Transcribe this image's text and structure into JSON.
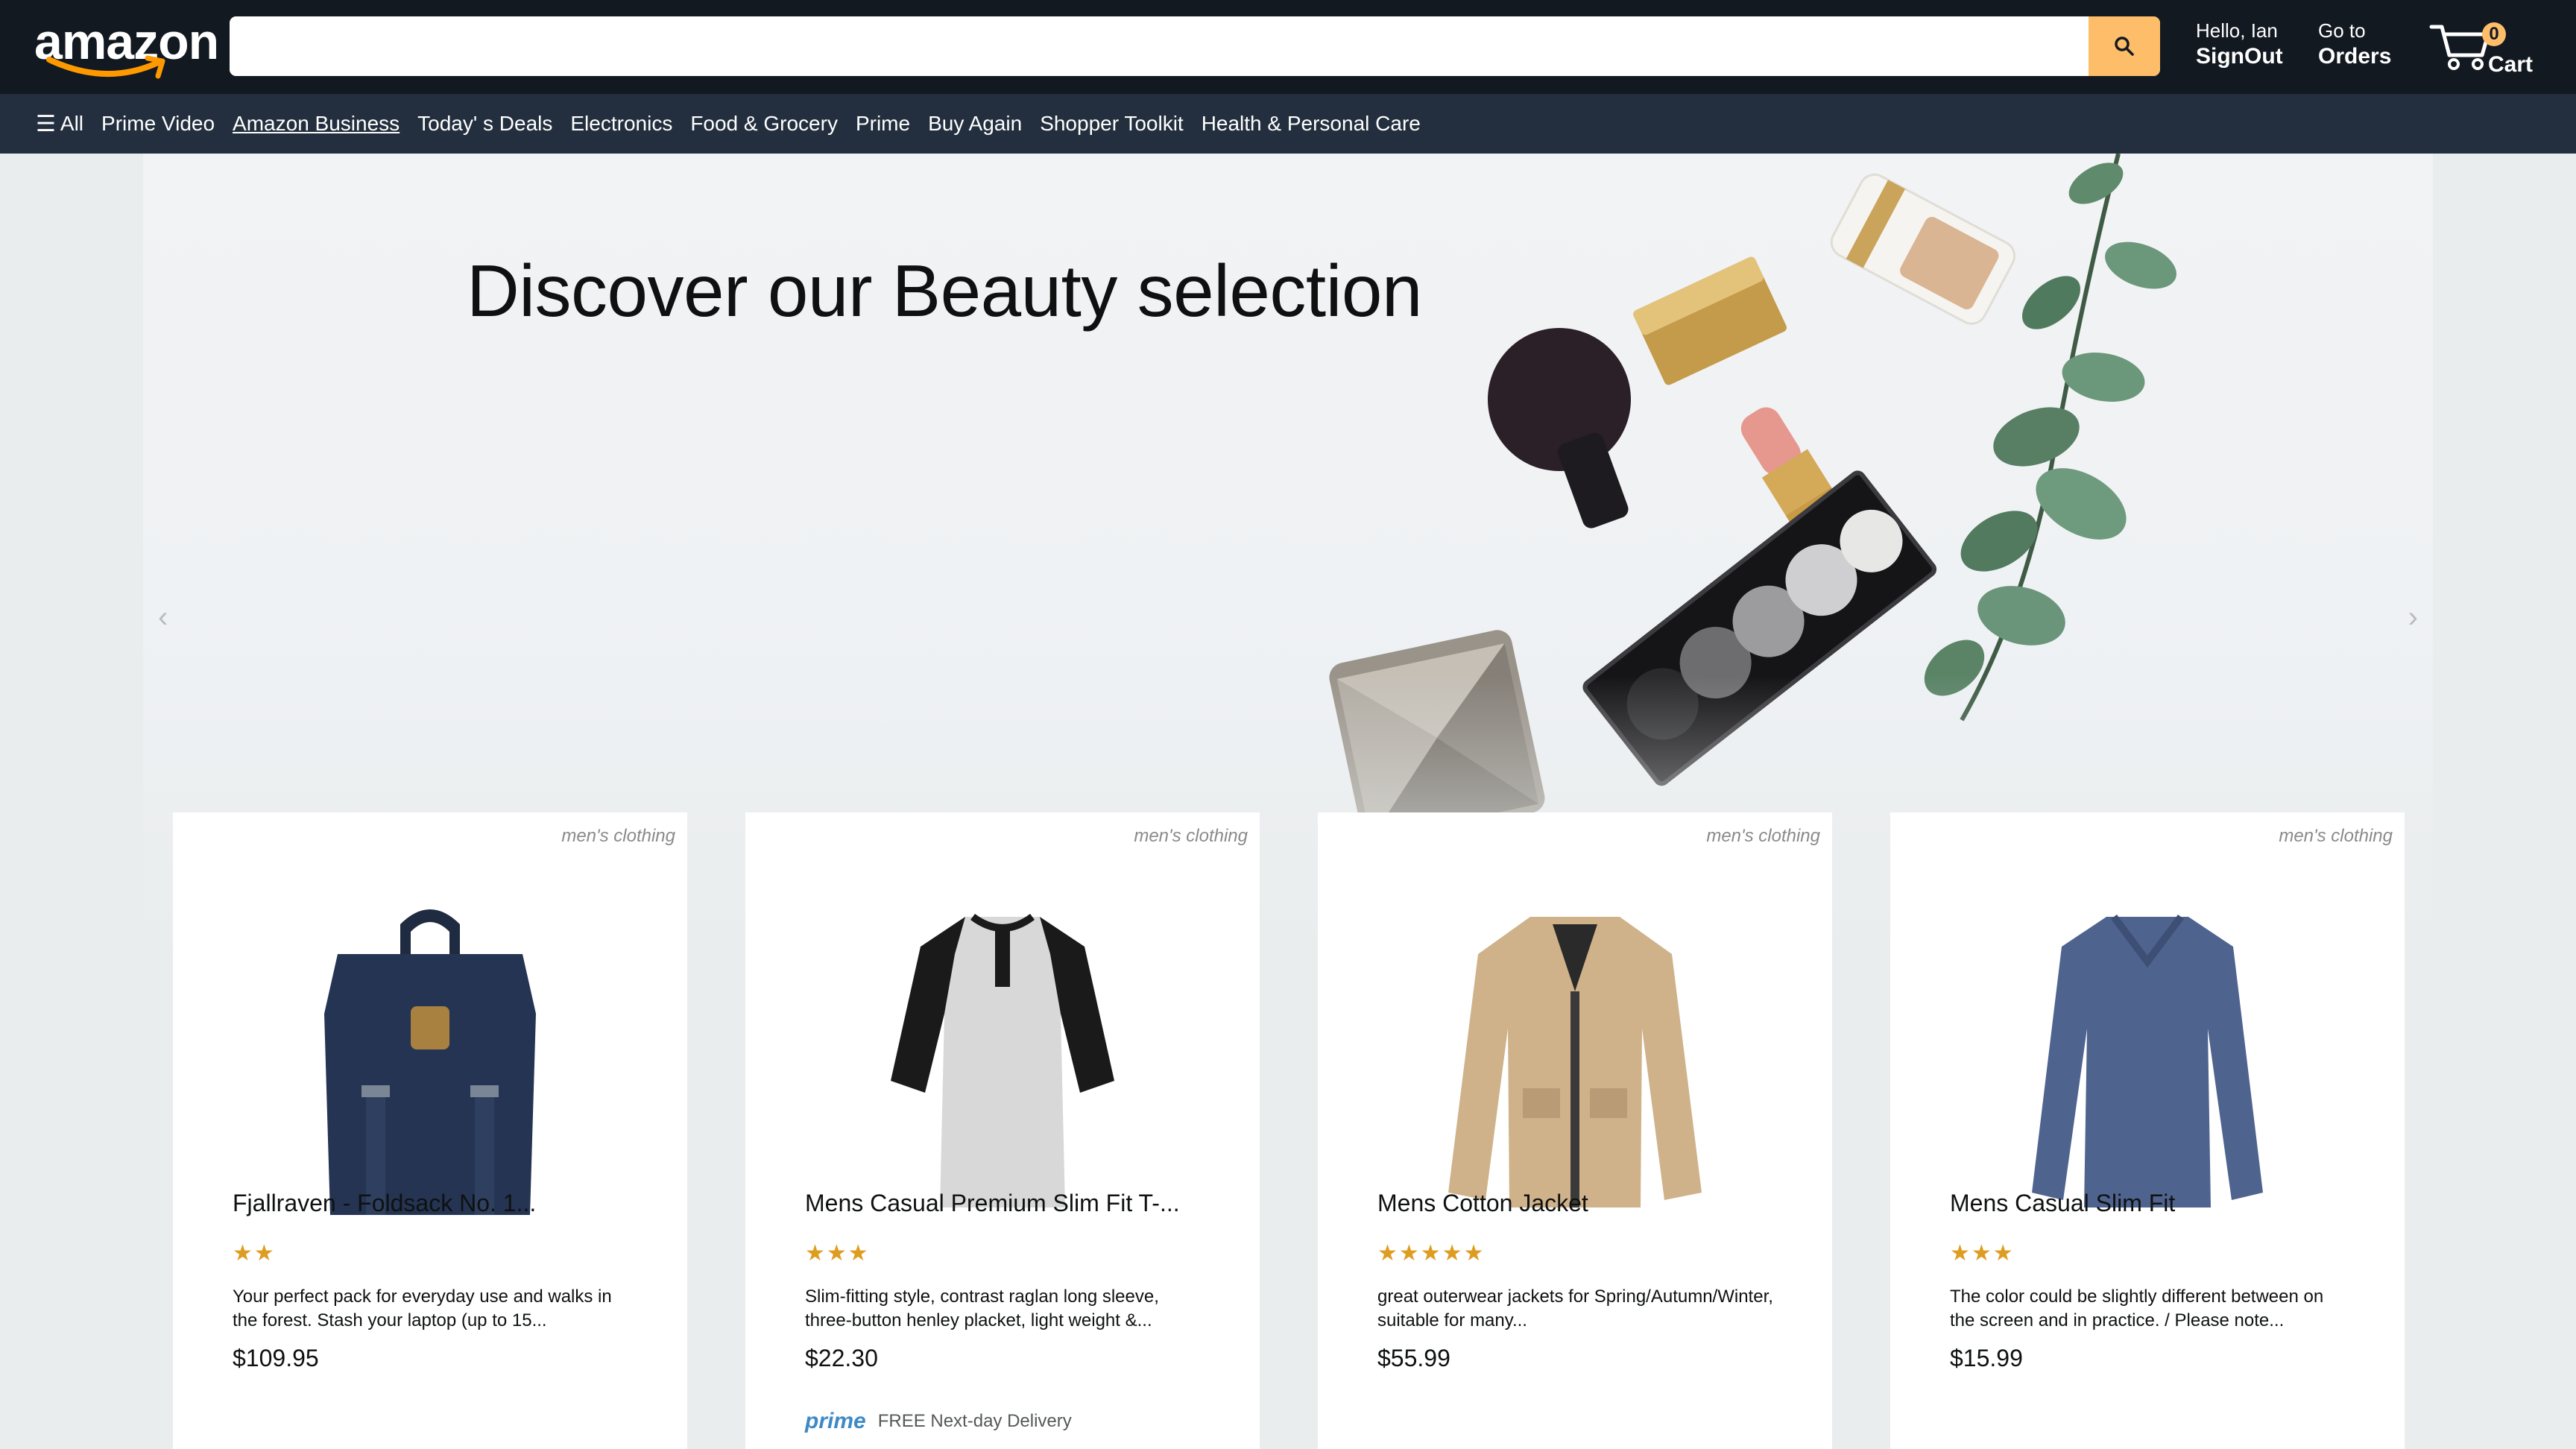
{
  "header": {
    "logo": "amazon",
    "search": {
      "value": "",
      "placeholder": ""
    },
    "search_icon": "search-icon",
    "greeting_small": "Hello, Ian",
    "greeting_big": "SignOut",
    "orders_small": "Go to",
    "orders_big": "Orders",
    "cart_count": "0",
    "cart_label": "Cart"
  },
  "subnav": {
    "all_label": "All",
    "items": [
      {
        "label": "Prime Video"
      },
      {
        "label": "Amazon Business"
      },
      {
        "label": "Today' s Deals"
      },
      {
        "label": "Electronics"
      },
      {
        "label": "Food & Grocery"
      },
      {
        "label": "Prime"
      },
      {
        "label": "Buy Again"
      },
      {
        "label": "Shopper Toolkit"
      },
      {
        "label": "Health & Personal Care"
      }
    ]
  },
  "hero": {
    "title": "Discover our Beauty selection"
  },
  "products": [
    {
      "category": "men's clothing",
      "title": "Fjallraven - Foldsack No. 1...",
      "stars": "★★",
      "desc": "Your perfect pack for everyday use and walks in the forest. Stash your laptop (up to 15...",
      "price": "$109.95"
    },
    {
      "category": "men's clothing",
      "title": "Mens Casual Premium Slim Fit T-...",
      "stars": "★★★",
      "desc": "Slim-fitting style, contrast raglan long sleeve, three-button henley placket, light weight &...",
      "price": "$22.30",
      "prime_logo": "prime",
      "prime_text": "FREE Next-day Delivery"
    },
    {
      "category": "men's clothing",
      "title": "Mens Cotton Jacket",
      "stars": "★★★★★",
      "desc": "great outerwear jackets for Spring/Autumn/Winter, suitable for many...",
      "price": "$55.99"
    },
    {
      "category": "men's clothing",
      "title": "Mens Casual Slim Fit",
      "stars": "★★★",
      "desc": "The color could be slightly different between on the screen and in practice. / Please note...",
      "price": "$15.99"
    }
  ],
  "colors": {
    "header_bg": "#131921",
    "subnav_bg": "#232f3e",
    "accent": "#febd69",
    "star": "#de9c20"
  }
}
